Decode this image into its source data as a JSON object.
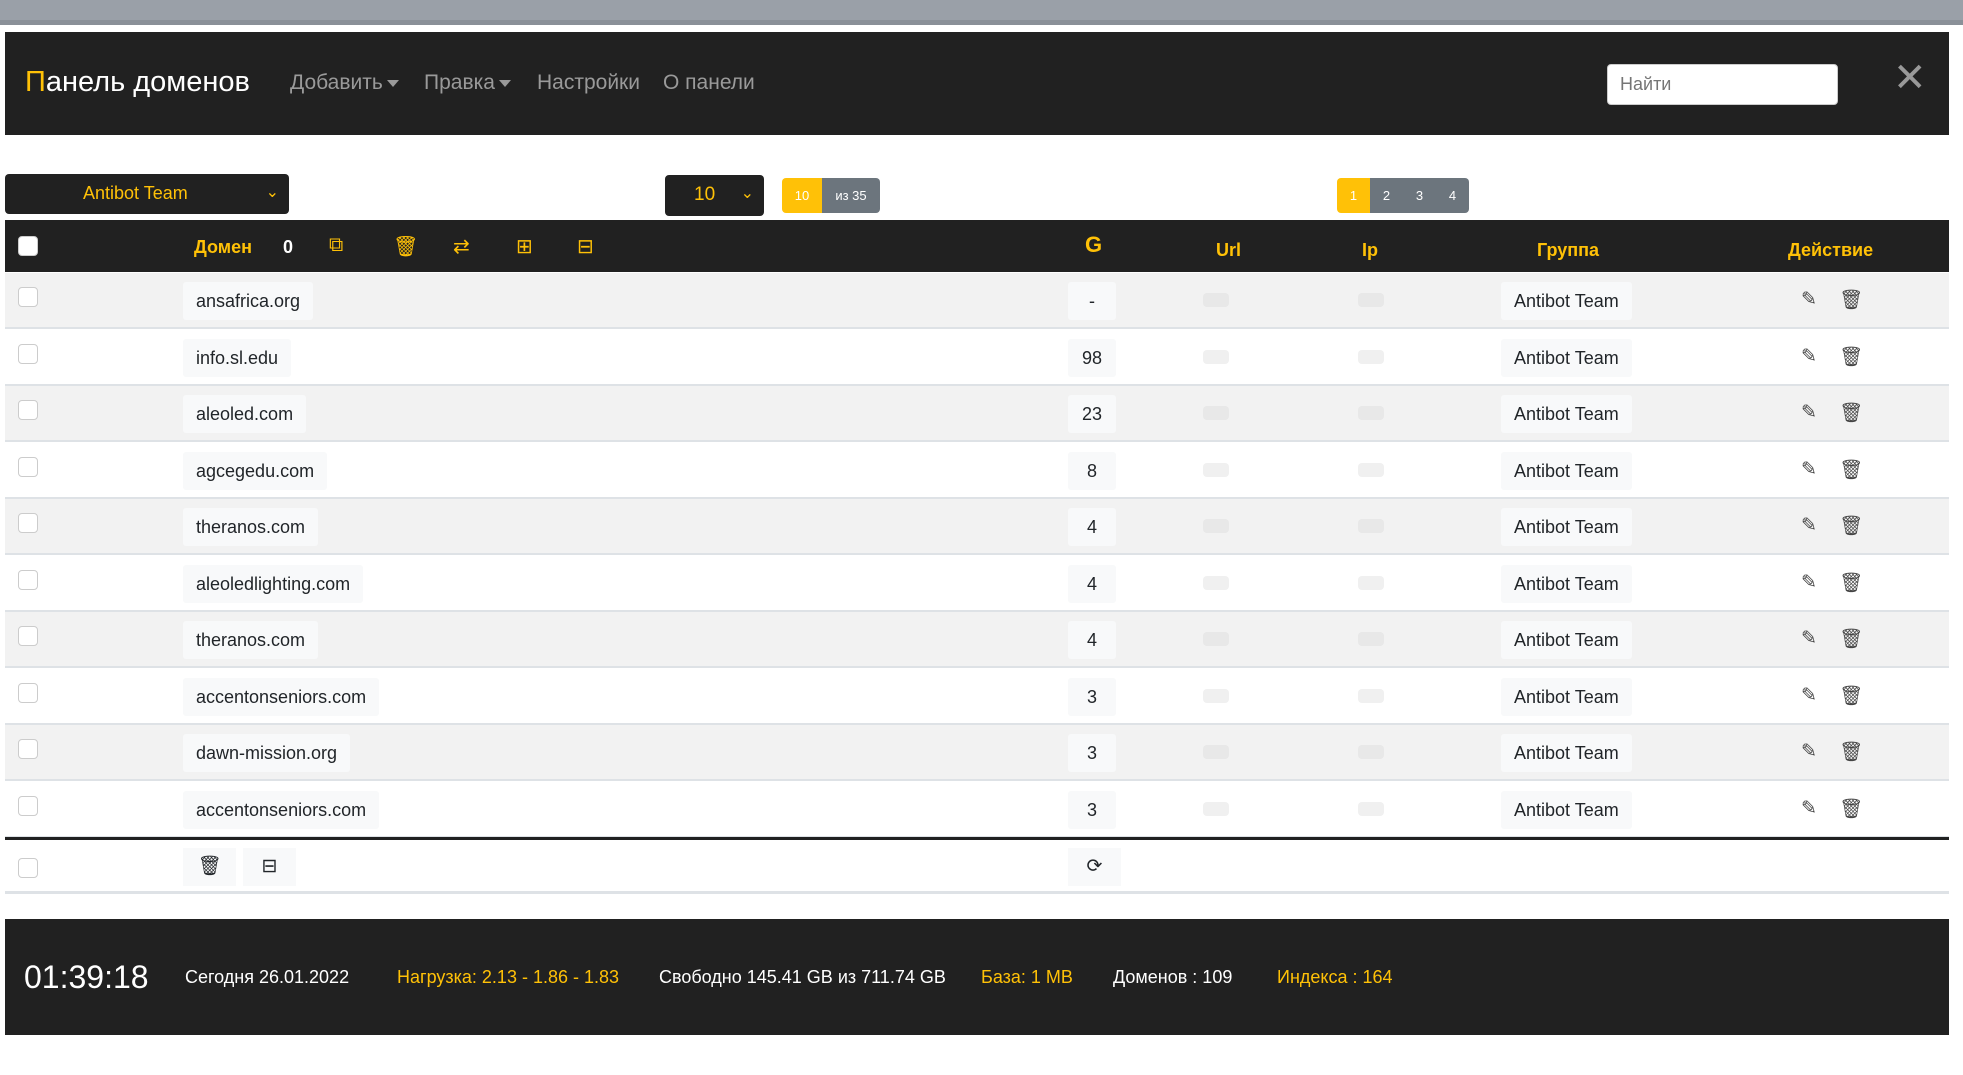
{
  "navbar": {
    "brand_first": "П",
    "brand_rest": "анель доменов",
    "menu": [
      "Добавить",
      "Правка",
      "Настройки",
      "О панели"
    ],
    "search_placeholder": "Найти"
  },
  "controls": {
    "group": "Antibot Team",
    "per_page": "10",
    "shown": "10",
    "total": "из 35",
    "pages": [
      "1",
      "2",
      "3",
      "4"
    ],
    "active_page": "1"
  },
  "table": {
    "headers": {
      "domain": "Домен",
      "selected_count": "0",
      "g": "G",
      "url": "Url",
      "ip": "Ip",
      "group": "Группа",
      "action": "Действие"
    },
    "rows": [
      {
        "domain": "ansafrica.org",
        "g": "-",
        "group": "Antibot Team"
      },
      {
        "domain": "info.sl.edu",
        "g": "98",
        "group": "Antibot Team"
      },
      {
        "domain": "aleoled.com",
        "g": "23",
        "group": "Antibot Team"
      },
      {
        "domain": "agcegedu.com",
        "g": "8",
        "group": "Antibot Team"
      },
      {
        "domain": "theranos.com",
        "g": "4",
        "group": "Antibot Team"
      },
      {
        "domain": "aleoledlighting.com",
        "g": "4",
        "group": "Antibot Team"
      },
      {
        "domain": "theranos.com",
        "g": "4",
        "group": "Antibot Team"
      },
      {
        "domain": "accentonseniors.com",
        "g": "3",
        "group": "Antibot Team"
      },
      {
        "domain": "dawn-mission.org",
        "g": "3",
        "group": "Antibot Team"
      },
      {
        "domain": "accentonseniors.com",
        "g": "3",
        "group": "Antibot Team"
      }
    ]
  },
  "status": {
    "time": "01:39:18",
    "date": "Сегодня 26.01.2022",
    "load": "Нагрузка: 2.13 - 1.86 - 1.83",
    "free": "Свободно 145.41 GB из 711.74 GB",
    "db": "База: 1 MB",
    "domains": "Доменов : 109",
    "index": "Индекса : 164"
  },
  "colors": {
    "accent": "#ffc107",
    "dark": "#212121"
  }
}
